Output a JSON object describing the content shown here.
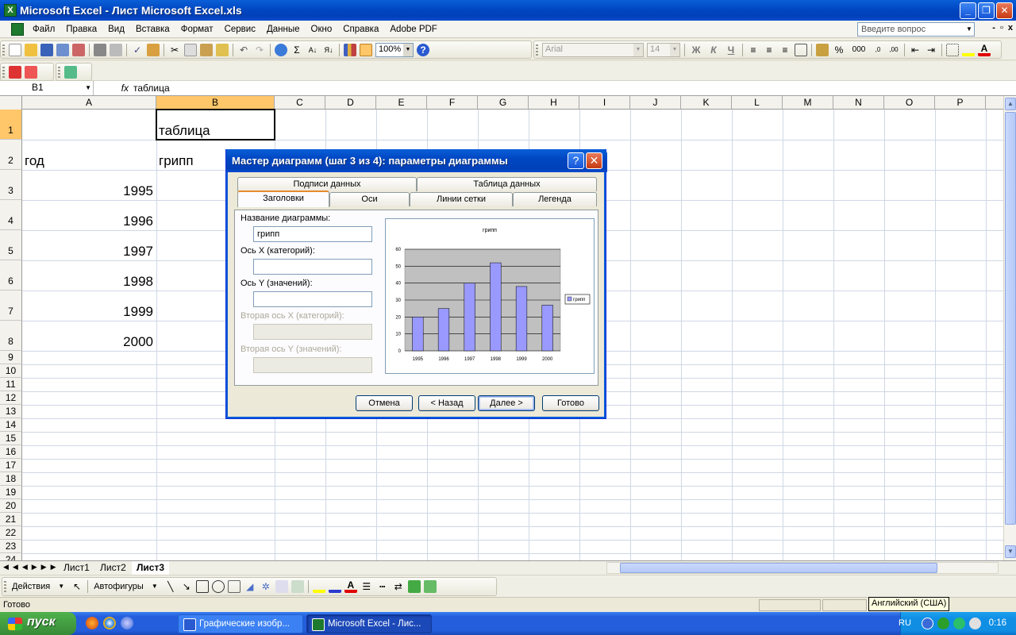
{
  "window": {
    "title": "Microsoft Excel - Лист Microsoft Excel.xls",
    "min": "_",
    "max": "❐",
    "close": "✕"
  },
  "menu": {
    "items": [
      "Файл",
      "Правка",
      "Вид",
      "Вставка",
      "Формат",
      "Сервис",
      "Данные",
      "Окно",
      "Справка",
      "Adobe PDF"
    ],
    "ask_placeholder": "Введите вопрос",
    "mdi_min": "-",
    "mdi_restore": "▫",
    "mdi_close": "x"
  },
  "toolbar": {
    "zoom": "100%",
    "font_name": "Arial",
    "font_size": "14",
    "bold": "Ж",
    "italic": "К",
    "underline": "Ч",
    "percent": "%",
    "thousands": "000"
  },
  "formula_bar": {
    "name_box": "B1",
    "fx": "fx",
    "value": "таблица"
  },
  "sheet": {
    "columns": [
      "A",
      "B",
      "C",
      "D",
      "E",
      "F",
      "G",
      "H",
      "I",
      "J",
      "K",
      "L",
      "M",
      "N",
      "O",
      "P"
    ],
    "rows": [
      "1",
      "2",
      "3",
      "4",
      "5",
      "6",
      "7",
      "8",
      "9",
      "10",
      "11",
      "12",
      "13",
      "14",
      "15",
      "16",
      "17",
      "18",
      "19",
      "20",
      "21",
      "22",
      "23",
      "24"
    ],
    "cells": {
      "B1": "таблица",
      "A2": "год",
      "B2": "грипп",
      "A3": "1995",
      "A4": "1996",
      "A5": "1997",
      "A6": "1998",
      "A7": "1999",
      "A8": "2000"
    },
    "tabs": [
      "Лист1",
      "Лист2",
      "Лист3"
    ],
    "active_tab": "Лист3"
  },
  "drawing_toolbar": {
    "actions": "Действия",
    "autoshapes": "Автофигуры"
  },
  "status": {
    "ready": "Готово",
    "language_tip": "Английский (США)"
  },
  "taskbar": {
    "start": "пуск",
    "tasks": [
      "Графические изобр...",
      "Microsoft Excel - Лис..."
    ],
    "lang": "RU",
    "clock": "0:16"
  },
  "dialog": {
    "title": "Мастер диаграмм (шаг 3 из 4): параметры диаграммы",
    "help": "?",
    "close": "✕",
    "tabs_back": [
      "Подписи данных",
      "Таблица данных"
    ],
    "tabs_front": [
      "Заголовки",
      "Оси",
      "Линии сетки",
      "Легенда"
    ],
    "active_tab": "Заголовки",
    "fields": {
      "chart_title_label": "Название диаграммы:",
      "chart_title_value": "грипп",
      "x_axis_label": "Ось X (категорий):",
      "x_axis_value": "",
      "y_axis_label": "Ось Y (значений):",
      "y_axis_value": "",
      "x2_axis_label": "Вторая ось X (категорий):",
      "y2_axis_label": "Вторая ось Y (значений):"
    },
    "buttons": {
      "cancel": "Отмена",
      "back": "< Назад",
      "next": "Далее >",
      "finish": "Готово"
    }
  },
  "chart_data": {
    "type": "bar",
    "title": "грипп",
    "categories": [
      "1995",
      "1996",
      "1997",
      "1998",
      "1999",
      "2000"
    ],
    "series": [
      {
        "name": "грипп",
        "values": [
          20,
          25,
          40,
          52,
          38,
          27
        ]
      }
    ],
    "ylim": [
      0,
      60
    ],
    "yticks": [
      "0",
      "10",
      "20",
      "30",
      "40",
      "50",
      "60"
    ],
    "grid": true,
    "legend": "right",
    "colors": {
      "bar": "#9999ff",
      "plot_bg": "#c0c0c0"
    }
  }
}
